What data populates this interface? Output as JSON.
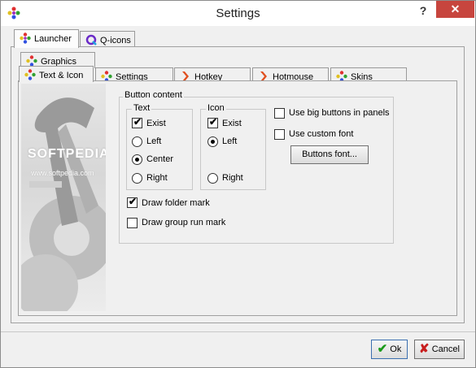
{
  "window": {
    "title": "Settings",
    "help": "?",
    "close": "✕"
  },
  "tabs_top": [
    {
      "label": "Launcher",
      "active": true
    },
    {
      "label": "Q-icons",
      "active": false
    }
  ],
  "tabs_row2": [
    {
      "label": "Graphics"
    }
  ],
  "tabs_row3": [
    {
      "label": "Text & Icon",
      "active": true
    },
    {
      "label": "Settings"
    },
    {
      "label": "Hotkey"
    },
    {
      "label": "Hotmouse"
    },
    {
      "label": "Skins"
    }
  ],
  "watermark": {
    "main": "SOFTPEDIA",
    "sub": "www.softpedia.com"
  },
  "button_content": {
    "legend": "Button content",
    "text_group": {
      "legend": "Text",
      "exist": {
        "label": "Exist",
        "checked": true
      },
      "options": [
        {
          "label": "Left",
          "selected": false
        },
        {
          "label": "Center",
          "selected": true
        },
        {
          "label": "Right",
          "selected": false
        }
      ]
    },
    "icon_group": {
      "legend": "Icon",
      "exist": {
        "label": "Exist",
        "checked": true
      },
      "options": [
        {
          "label": "Left",
          "selected": true
        },
        {
          "label": "Right",
          "selected": false
        }
      ]
    },
    "use_big_buttons": {
      "label": "Use big buttons in panels",
      "checked": false
    },
    "use_custom_font": {
      "label": "Use custom font",
      "checked": false
    },
    "buttons_font_label": "Buttons font...",
    "draw_folder_mark": {
      "label": "Draw folder mark",
      "checked": true
    },
    "draw_group_run_mark": {
      "label": "Draw group run mark",
      "checked": false
    }
  },
  "footer": {
    "ok_label": "Ok",
    "cancel_label": "Cancel"
  },
  "colors": {
    "ok_check": "#1a9a1a",
    "cancel_x": "#c81e1e",
    "close_bg": "#c7453e"
  }
}
